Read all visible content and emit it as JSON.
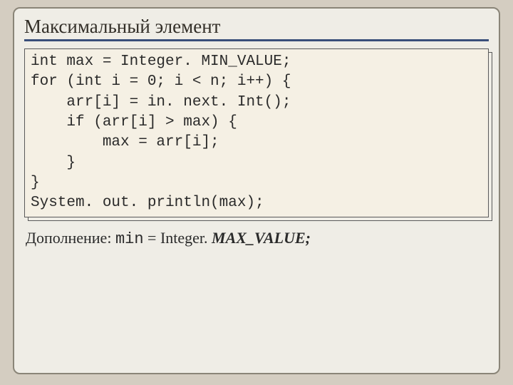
{
  "title": "Максимальный элемент",
  "code": "int max = Integer. MIN_VALUE;\nfor (int i = 0; i < n; i++) {\n    arr[i] = in. next. Int();\n    if (arr[i] > max) {\n        max = arr[i];\n    }\n}\nSystem. out. println(max);",
  "supplement": {
    "label": "Дополнение:",
    "var": "min",
    "eq": " = Integer. ",
    "bold": "MAX_VALUE;"
  }
}
